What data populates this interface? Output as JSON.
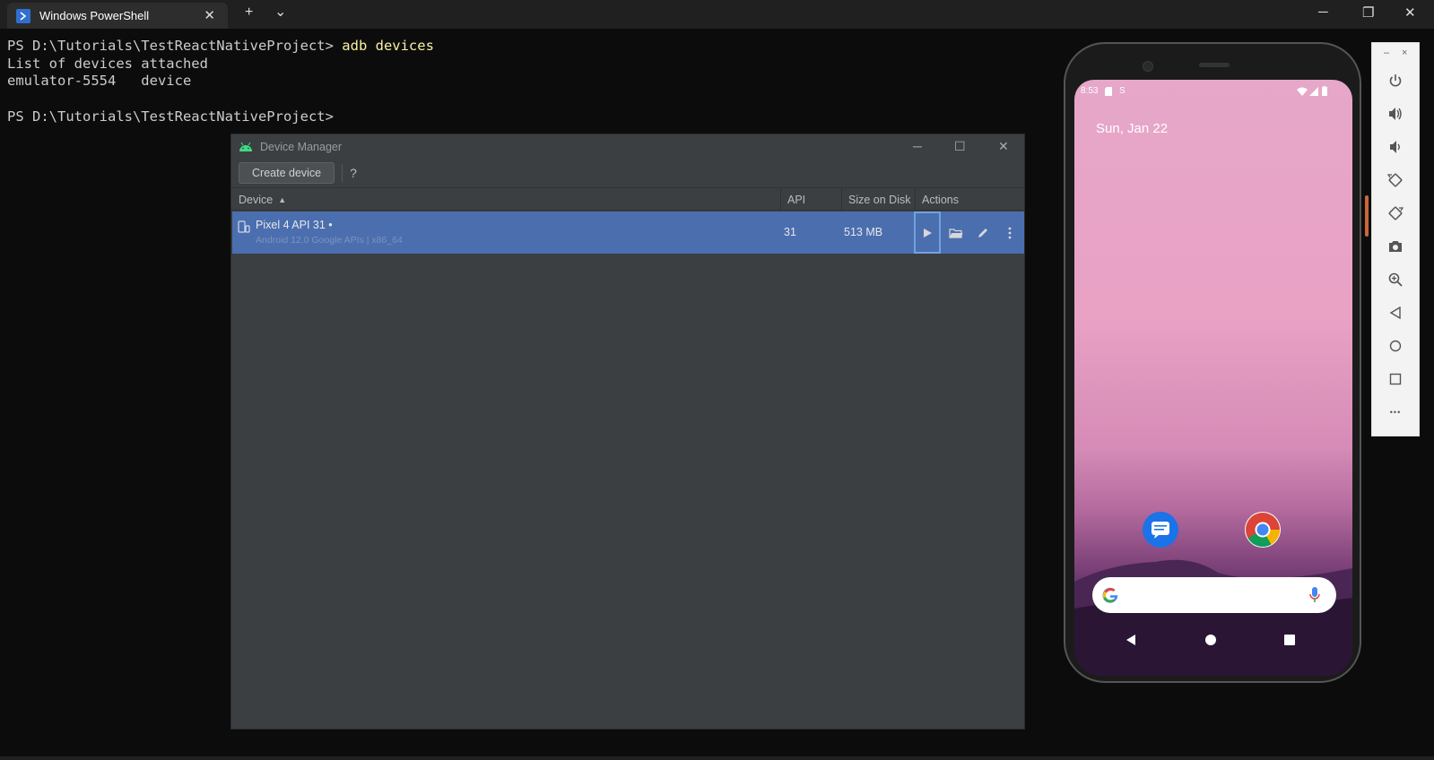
{
  "tabbar": {
    "tab_title": "Windows PowerShell",
    "new_tab_symbol": "+",
    "dropdown_symbol": "⌄",
    "close_symbol": "✕",
    "minimize_symbol": "─",
    "restore_symbol": "❐",
    "window_close_symbol": "✕"
  },
  "terminal": {
    "line1_prompt": "PS D:\\Tutorials\\TestReactNativeProject> ",
    "line1_cmd": "adb devices",
    "line2": "List of devices attached",
    "line3": "emulator-5554   device",
    "line4": "",
    "line5": "PS D:\\Tutorials\\TestReactNativeProject>"
  },
  "device_manager": {
    "title": "Device Manager",
    "create_button": "Create device",
    "help": "?",
    "minimize": "─",
    "maximize": "☐",
    "close": "✕",
    "columns": {
      "device": "Device",
      "api": "API",
      "size": "Size on Disk",
      "actions": "Actions"
    },
    "sort_indicator": "▲",
    "row": {
      "name": "Pixel 4 API 31  •",
      "sub": "Android 12.0 Google APIs | x86_64",
      "api": "31",
      "size": "513 MB"
    }
  },
  "phone": {
    "time": "8:53",
    "status_s": "S",
    "date": "Sun, Jan 22"
  },
  "emulator_toolbar": {
    "minimize": "–",
    "close": "×",
    "more": "•••"
  },
  "colors": {
    "terminal_bg": "#0c0c0c",
    "command": "#f9f1a5",
    "selection": "#4b6eaf",
    "dm_bg": "#3c3f41"
  }
}
